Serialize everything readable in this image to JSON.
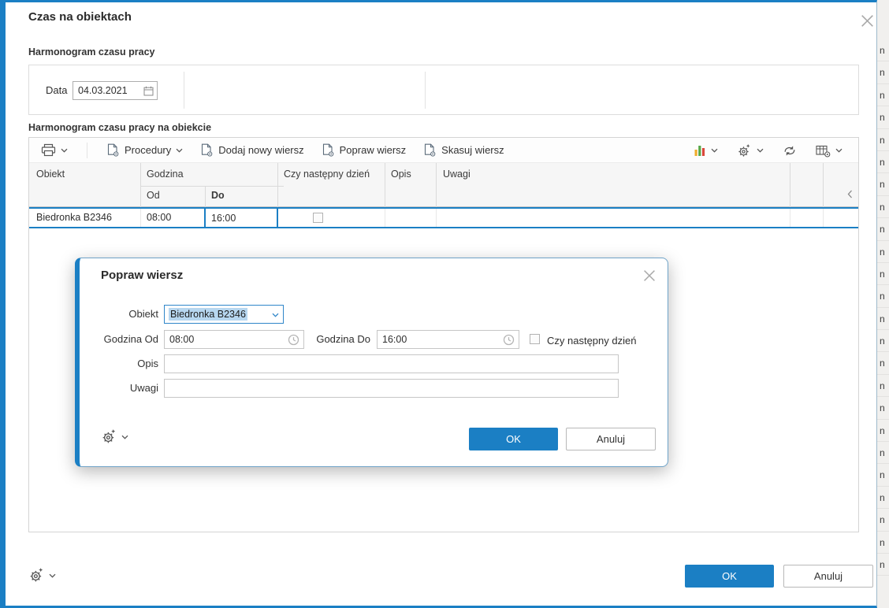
{
  "colors": {
    "accent": "#1b7fc4"
  },
  "main_dialog": {
    "title": "Czas na obiektach",
    "schedule_section": {
      "title": "Harmonogram czasu pracy",
      "date_label": "Data",
      "date_value": "04.03.2021"
    },
    "grid_section": {
      "title": "Harmonogram czasu pracy na obiekcie",
      "toolbar": {
        "procedury_label": "Procedury",
        "add_row_label": "Dodaj nowy wiersz",
        "edit_row_label": "Popraw wiersz",
        "delete_row_label": "Skasuj wiersz"
      },
      "table": {
        "headers": {
          "obiekt": "Obiekt",
          "godzina": "Godzina",
          "od": "Od",
          "do": "Do",
          "next_day": "Czy następny dzień",
          "opis": "Opis",
          "uwagi": "Uwagi"
        },
        "rows": [
          {
            "obiekt": "Biedronka B2346",
            "od": "08:00",
            "do": "16:00",
            "next_day": false,
            "opis": "",
            "uwagi": ""
          }
        ]
      }
    },
    "footer": {
      "ok_label": "OK",
      "cancel_label": "Anuluj"
    }
  },
  "edit_dialog": {
    "title": "Popraw wiersz",
    "obiekt_label": "Obiekt",
    "obiekt_value": "Biedronka B2346",
    "godzina_od_label": "Godzina Od",
    "godzina_od_value": "08:00",
    "godzina_do_label": "Godzina Do",
    "godzina_do_value": "16:00",
    "next_day_label": "Czy następny dzień",
    "next_day_checked": false,
    "opis_label": "Opis",
    "opis_value": "",
    "uwagi_label": "Uwagi",
    "uwagi_value": "",
    "ok_label": "OK",
    "cancel_label": "Anuluj"
  },
  "background_window": {
    "fragments": [
      "n",
      "n",
      "n",
      "n",
      "n",
      "n",
      "n",
      "n",
      "n",
      "n",
      "n",
      "n",
      "n",
      "n",
      "n",
      "n",
      "n",
      "n",
      "n",
      "n",
      "n",
      "n",
      "n",
      "n"
    ]
  }
}
